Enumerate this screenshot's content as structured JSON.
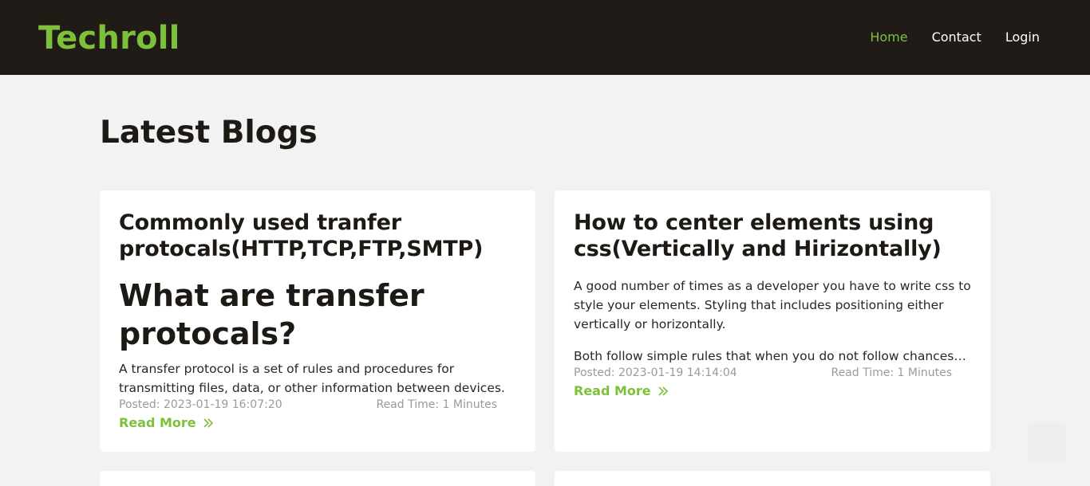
{
  "nav": {
    "brand": "Techroll",
    "links": [
      "Home",
      "Contact",
      "Login"
    ]
  },
  "page": {
    "title": "Latest Blogs"
  },
  "posts": [
    {
      "title": "Commonly used tranfer protocals(HTTP,TCP,FTP,SMTP)",
      "subtitle": "What are transfer protocals?",
      "excerpt": "A transfer protocol is a set of rules and procedures for transmitting files, data, or other information between devices.",
      "posted": "Posted: 2023-01-19 16:07:20",
      "read_time": "Read Time: 1 Minutes",
      "read_more": "Read More"
    },
    {
      "title": "How to center elements using css(Vertically and Hirizontally)",
      "excerpt": "A good number of times as a developer you have to write css to style your elements. Styling that includes positioning either vertically or horizontally.",
      "excerpt_2": "Both follow simple rules that when you do not follow chances are you will get stuck.",
      "posted": "Posted: 2023-01-19 14:14:04",
      "read_time": "Read Time: 1 Minutes",
      "read_more": "Read More"
    }
  ],
  "colors": {
    "accent": "#7dc13a",
    "navbar": "#211b17",
    "background": "#f2f2f2"
  }
}
